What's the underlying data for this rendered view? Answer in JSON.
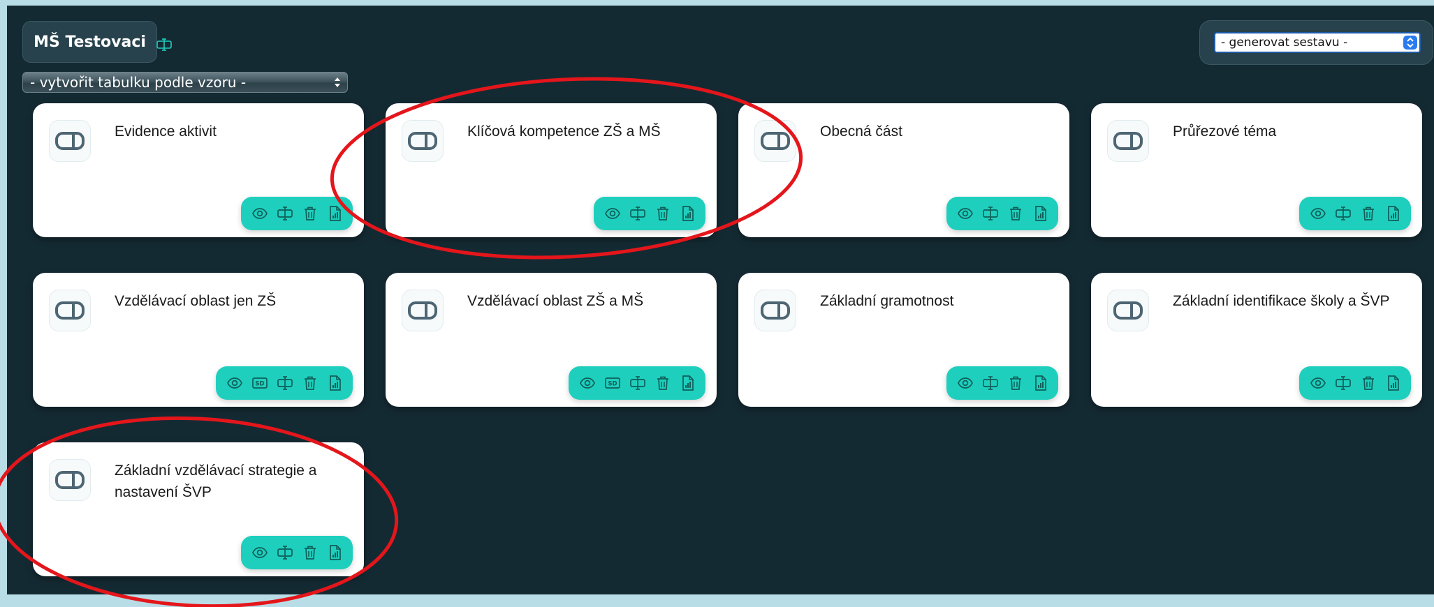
{
  "header": {
    "school_name": "MŠ Testovaci",
    "template_select_value": "- vytvořit tabulku podle vzoru -",
    "report_select_value": "- generovat sestavu -"
  },
  "colors": {
    "background": "#142a33",
    "toolbar": "#1fcfbe",
    "card": "#ffffff",
    "annotation": "#e4161b"
  },
  "cards": [
    {
      "title": "Evidence aktivit",
      "actions": [
        "eye-icon",
        "rename-icon",
        "trash-icon",
        "chart-file-icon"
      ]
    },
    {
      "title": "Klíčová kompetence ZŠ a MŠ",
      "actions": [
        "eye-icon",
        "rename-icon",
        "trash-icon",
        "chart-file-icon"
      ]
    },
    {
      "title": "Obecná část",
      "actions": [
        "eye-icon",
        "rename-icon",
        "trash-icon",
        "chart-file-icon"
      ]
    },
    {
      "title": "Průřezové téma",
      "actions": [
        "eye-icon",
        "rename-icon",
        "trash-icon",
        "chart-file-icon"
      ]
    },
    {
      "title": "Vzdělávací oblast jen ZŠ",
      "actions": [
        "eye-icon",
        "sd-icon",
        "rename-icon",
        "trash-icon",
        "chart-file-icon"
      ],
      "sd_label": "SD"
    },
    {
      "title": "Vzdělávací oblast ZŠ a MŠ",
      "actions": [
        "eye-icon",
        "sd-icon",
        "rename-icon",
        "trash-icon",
        "chart-file-icon"
      ],
      "sd_label": "SD"
    },
    {
      "title": "Základní gramotnost",
      "actions": [
        "eye-icon",
        "rename-icon",
        "trash-icon",
        "chart-file-icon"
      ]
    },
    {
      "title": "Základní identifikace školy a ŠVP",
      "actions": [
        "eye-icon",
        "rename-icon",
        "trash-icon",
        "chart-file-icon"
      ]
    },
    {
      "title": "Základní vzdělávací strategie a nastavení ŠVP",
      "actions": [
        "eye-icon",
        "rename-icon",
        "trash-icon",
        "chart-file-icon"
      ]
    }
  ]
}
